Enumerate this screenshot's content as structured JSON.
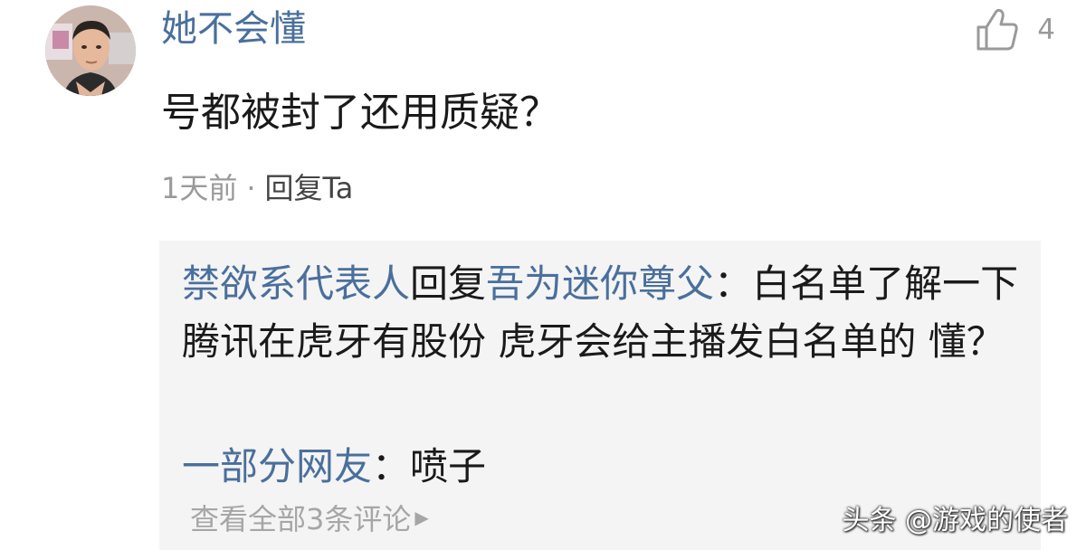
{
  "comment": {
    "username": "她不会懂",
    "like_count": "4",
    "text": "号都被封了还用质疑？",
    "time": "1天前",
    "separator": "·",
    "reply_label": "回复Ta"
  },
  "replies": [
    {
      "author": "禁欲系代表人",
      "reply_word": "回复",
      "reply_to": "吾为迷你尊父",
      "colon": "：",
      "text": "白名单了解一下 腾讯在虎牙有股份 虎牙会给主播发白名单的 懂？"
    },
    {
      "author": "一部分网友",
      "colon": "：",
      "text": "喷子"
    }
  ],
  "view_all_label": "查看全部3条评论",
  "watermark": "头条 @游戏的使者",
  "icons": {
    "avatar": "user-avatar",
    "like": "thumbs-up-icon",
    "more": "triangle-right-icon"
  },
  "colors": {
    "username": "#4a6f9c",
    "reply_box_bg": "#f4f4f4",
    "meta_gray": "#9a9a9a"
  }
}
